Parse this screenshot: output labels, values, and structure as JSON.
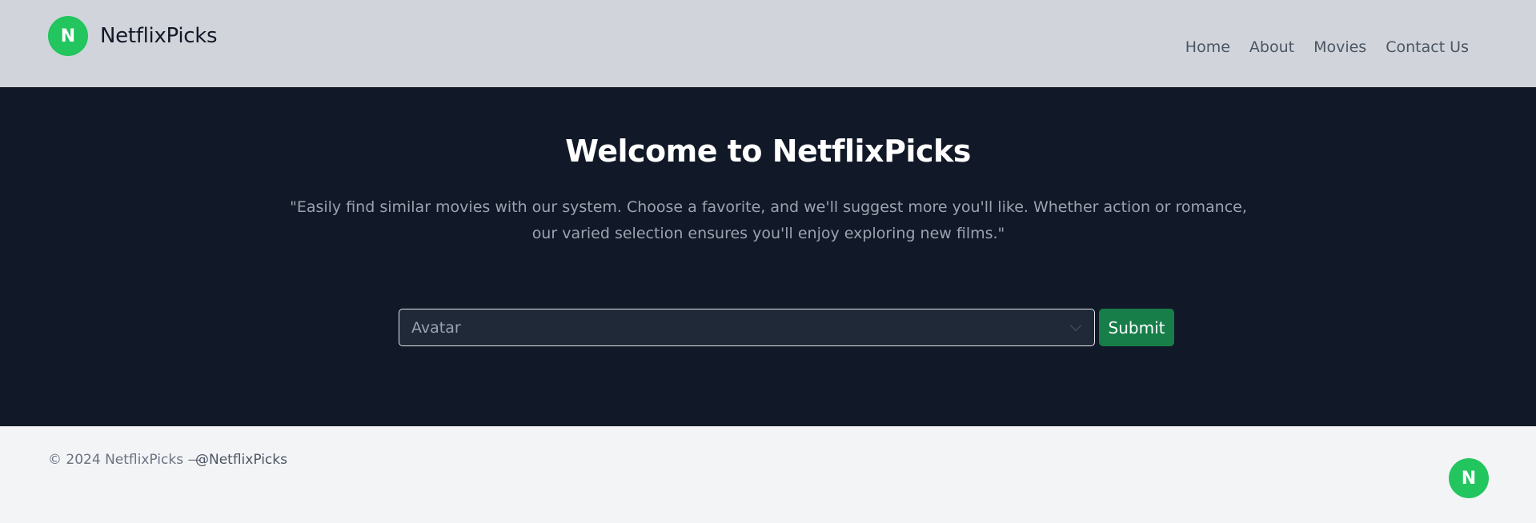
{
  "header": {
    "logo_letter": "N",
    "brand": "NetflixPicks",
    "nav": [
      "Home",
      "About",
      "Movies",
      "Contact Us"
    ]
  },
  "hero": {
    "title": "Welcome to NetflixPicks",
    "description": "\"Easily find similar movies with our system. Choose a favorite, and we'll suggest more you'll like. Whether action or romance, our varied selection ensures you'll enjoy exploring new films.\"",
    "select_value": "Avatar",
    "submit_label": "Submit"
  },
  "footer": {
    "copyright": "© 2024 NetflixPicks —",
    "handle": "@NetflixPicks",
    "logo_letter": "N"
  },
  "colors": {
    "header_bg": "#d1d5db",
    "hero_bg": "#111827",
    "accent_green": "#22c55e",
    "submit_green": "#177e4a",
    "footer_bg": "#f3f4f6"
  }
}
